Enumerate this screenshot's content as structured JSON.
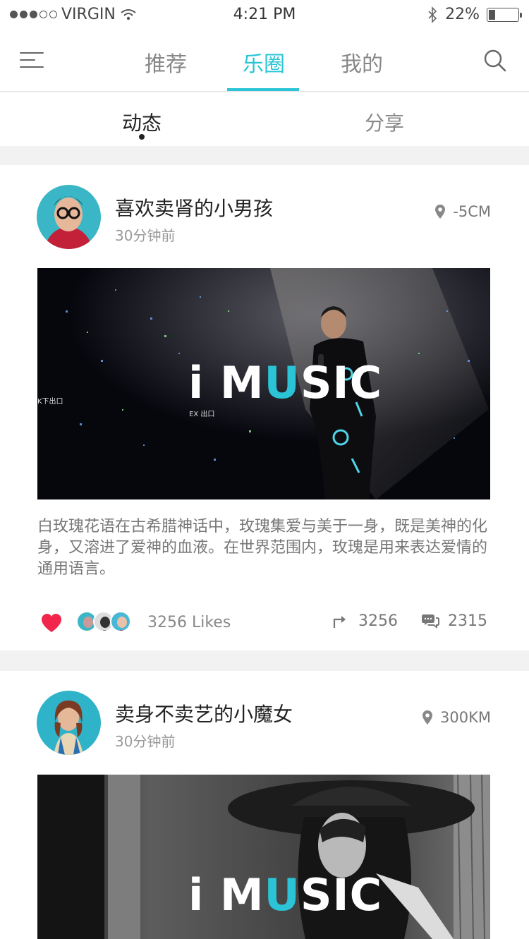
{
  "status_bar": {
    "carrier": "VIRGIN",
    "time": "4:21 PM",
    "battery": "22%",
    "battery_level": 0.22,
    "icons": [
      "signal-dots-icon",
      "wifi-icon",
      "bluetooth-icon",
      "battery-icon"
    ]
  },
  "nav": {
    "tabs": [
      {
        "label": "推荐",
        "active": false
      },
      {
        "label": "乐圈",
        "active": true
      },
      {
        "label": "我的",
        "active": false
      }
    ],
    "accent_color": "#2ac4d6"
  },
  "subnav": {
    "tabs": [
      {
        "label": "动态",
        "active": true
      },
      {
        "label": "分享",
        "active": false
      }
    ]
  },
  "posts": [
    {
      "username": "喜欢卖肾的小男孩",
      "time_ago": "30分钟前",
      "distance": "-5CM",
      "image_brand": {
        "prefix": "i M",
        "accent": "U",
        "suffix": "SIC"
      },
      "image_caption_left": "K下出口",
      "image_caption_mid": "EX 出口",
      "description": "白玫瑰花语在古希腊神话中，玫瑰集爱与美于一身，既是美神的化身，又溶进了爱神的血液。在世界范围内，玫瑰是用来表达爱情的通用语言。",
      "likes": "3256 Likes",
      "shares": "3256",
      "comments": "2315"
    },
    {
      "username": "卖身不卖艺的小魔女",
      "time_ago": "30分钟前",
      "distance": "300KM",
      "image_brand": {
        "prefix": "i M",
        "accent": "U",
        "suffix": "SIC"
      }
    }
  ]
}
